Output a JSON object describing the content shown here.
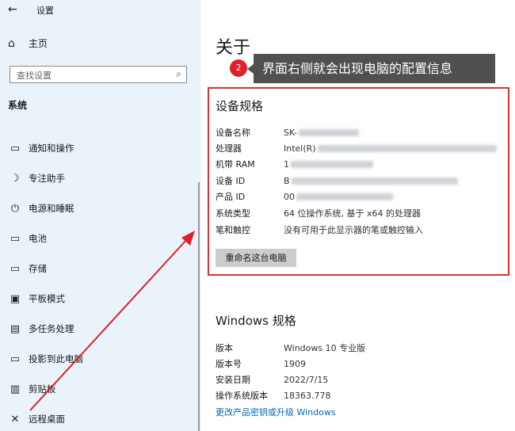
{
  "window": {
    "back_glyph": "←",
    "title": "设置"
  },
  "sidebar": {
    "home": {
      "icon": "home-icon",
      "glyph": "⌂",
      "label": "主页"
    },
    "search": {
      "placeholder": "查找设置",
      "icon": "search-icon",
      "glyph": "⌕"
    },
    "section_title": "系统",
    "items": [
      {
        "icon": "notification-icon",
        "glyph": "▭",
        "label": "通知和操作"
      },
      {
        "icon": "focus-assist-icon",
        "glyph": "☽",
        "label": "专注助手"
      },
      {
        "icon": "power-icon",
        "glyph": "⏻",
        "label": "电源和睡眠"
      },
      {
        "icon": "battery-icon",
        "glyph": "▭",
        "label": "电池"
      },
      {
        "icon": "storage-icon",
        "glyph": "▭",
        "label": "存储"
      },
      {
        "icon": "tablet-mode-icon",
        "glyph": "▣",
        "label": "平板模式"
      },
      {
        "icon": "multitasking-icon",
        "glyph": "▤",
        "label": "多任务处理"
      },
      {
        "icon": "project-icon",
        "glyph": "▭",
        "label": "投影到此电脑"
      },
      {
        "icon": "clipboard-icon",
        "glyph": "▥",
        "label": "剪贴板"
      },
      {
        "icon": "remote-desktop-icon",
        "glyph": "✕",
        "label": "远程桌面"
      }
    ]
  },
  "main": {
    "title": "关于",
    "annotation": {
      "step": "2",
      "text": "界面右侧就会出现电脑的配置信息"
    },
    "device_specs": {
      "heading": "设备规格",
      "rows": [
        {
          "key": "设备名称",
          "value": "SK-"
        },
        {
          "key": "处理器",
          "value": "Intel(R)"
        },
        {
          "key": "机带 RAM",
          "value": "1"
        },
        {
          "key": "设备 ID",
          "value": "B"
        },
        {
          "key": "产品 ID",
          "value": "00"
        },
        {
          "key": "系统类型",
          "value": "64 位操作系统, 基于 x64 的处理器"
        },
        {
          "key": "笔和触控",
          "value": "没有可用于此显示器的笔或触控输入"
        }
      ],
      "rename_button": "重命名这台电脑"
    },
    "windows_specs": {
      "heading": "Windows 规格",
      "rows": [
        {
          "key": "版本",
          "value": "Windows 10 专业版"
        },
        {
          "key": "版本号",
          "value": "1909"
        },
        {
          "key": "安装日期",
          "value": "2022/7/15"
        },
        {
          "key": "操作系统版本",
          "value": "18363.778"
        }
      ],
      "link": "更改产品密钥或升级 Windows"
    }
  },
  "colors": {
    "sidebar_bg": "#e9f3f9",
    "highlight": "#d9342b",
    "link": "#0067b8",
    "callout_bg": "#505050"
  }
}
